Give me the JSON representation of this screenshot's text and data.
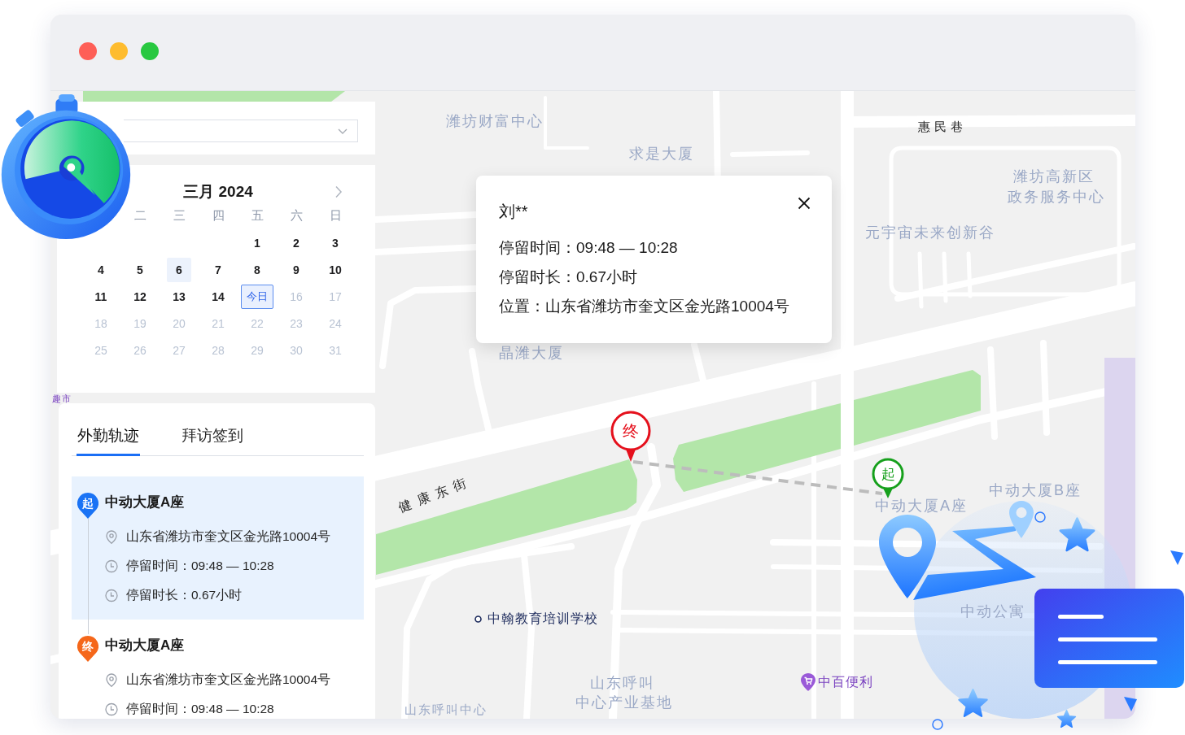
{
  "window": {
    "controls": [
      {
        "kind": "close"
      },
      {
        "kind": "minimize"
      },
      {
        "kind": "maximize"
      }
    ]
  },
  "calendar": {
    "title": "三月 2024",
    "weekdays": [
      "二",
      "三",
      "四",
      "五",
      "六",
      "日"
    ],
    "weeks": [
      [
        {
          "label": "1",
          "selected": false,
          "today": false,
          "disabled": false
        },
        {
          "label": "2",
          "selected": false,
          "today": false,
          "disabled": false
        },
        {
          "label": "3",
          "selected": false,
          "today": false,
          "disabled": false
        }
      ],
      [
        {
          "label": "4",
          "selected": false,
          "today": false,
          "disabled": false
        },
        {
          "label": "5",
          "selected": false,
          "today": false,
          "disabled": false
        },
        {
          "label": "6",
          "selected": true,
          "today": false,
          "disabled": false
        },
        {
          "label": "7",
          "selected": false,
          "today": false,
          "disabled": false
        },
        {
          "label": "8",
          "selected": false,
          "today": false,
          "disabled": false
        },
        {
          "label": "9",
          "selected": false,
          "today": false,
          "disabled": false
        },
        {
          "label": "10",
          "selected": false,
          "today": false,
          "disabled": false
        }
      ],
      [
        {
          "label": "11",
          "selected": false,
          "today": false,
          "disabled": false
        },
        {
          "label": "12",
          "selected": false,
          "today": false,
          "disabled": false
        },
        {
          "label": "13",
          "selected": false,
          "today": false,
          "disabled": false
        },
        {
          "label": "14",
          "selected": false,
          "today": false,
          "disabled": false
        },
        {
          "label": "今日",
          "selected": false,
          "today": true,
          "disabled": false
        },
        {
          "label": "16",
          "selected": false,
          "today": false,
          "disabled": true
        },
        {
          "label": "17",
          "selected": false,
          "today": false,
          "disabled": true
        }
      ],
      [
        {
          "label": "18",
          "selected": false,
          "today": false,
          "disabled": true
        },
        {
          "label": "19",
          "selected": false,
          "today": false,
          "disabled": true
        },
        {
          "label": "20",
          "selected": false,
          "today": false,
          "disabled": true
        },
        {
          "label": "21",
          "selected": false,
          "today": false,
          "disabled": true
        },
        {
          "label": "22",
          "selected": false,
          "today": false,
          "disabled": true
        },
        {
          "label": "23",
          "selected": false,
          "today": false,
          "disabled": true
        },
        {
          "label": "24",
          "selected": false,
          "today": false,
          "disabled": true
        }
      ],
      [
        {
          "label": "25",
          "selected": false,
          "today": false,
          "disabled": true
        },
        {
          "label": "26",
          "selected": false,
          "today": false,
          "disabled": true
        },
        {
          "label": "27",
          "selected": false,
          "today": false,
          "disabled": true
        },
        {
          "label": "28",
          "selected": false,
          "today": false,
          "disabled": true
        },
        {
          "label": "29",
          "selected": false,
          "today": false,
          "disabled": true
        },
        {
          "label": "30",
          "selected": false,
          "today": false,
          "disabled": true
        },
        {
          "label": "31",
          "selected": false,
          "today": false,
          "disabled": true
        }
      ]
    ]
  },
  "tabs": [
    {
      "label": "外勤轨迹",
      "selected": true
    },
    {
      "label": "拜访签到",
      "selected": false
    }
  ],
  "visits": [
    {
      "marker": "起",
      "color": "#1a73f5",
      "title": "中动大厦A座",
      "selected": true,
      "rows": [
        {
          "kind": "address",
          "text": "山东省潍坊市奎文区金光路10004号"
        },
        {
          "kind": "time",
          "text": "停留时间：09:48 — 10:28"
        },
        {
          "kind": "time",
          "text": "停留时长：0.67小时"
        }
      ]
    },
    {
      "marker": "终",
      "color": "#f5671a",
      "title": "中动大厦A座",
      "selected": false,
      "rows": [
        {
          "kind": "address",
          "text": "山东省潍坊市奎文区金光路10004号"
        },
        {
          "kind": "time",
          "text": "停留时间：09:48 — 10:28"
        }
      ]
    }
  ],
  "map": {
    "labels": [
      {
        "text": "潍坊财富中心",
        "kind": "area"
      },
      {
        "text": "求是大厦",
        "kind": "area"
      },
      {
        "text": "惠民巷",
        "kind": "road"
      },
      {
        "text": "潍坊高新区",
        "kind": "area"
      },
      {
        "text": "政务服务中心",
        "kind": "area"
      },
      {
        "text": "元宇宙未来创新谷",
        "kind": "area"
      },
      {
        "text": "晶潍大厦",
        "kind": "area"
      },
      {
        "text": "趣市",
        "kind": "district"
      },
      {
        "text": "健康东街",
        "kind": "road"
      },
      {
        "text": "中动大厦B座",
        "kind": "area"
      },
      {
        "text": "中动大厦A座",
        "kind": "area"
      },
      {
        "text": "中动公寓",
        "kind": "area"
      },
      {
        "text": "中翰教育培训学校",
        "kind": "poi"
      },
      {
        "text": "山东呼叫",
        "kind": "area"
      },
      {
        "text": "中心产业基地",
        "kind": "area"
      },
      {
        "text": "中百便利",
        "kind": "shop"
      },
      {
        "text": "山东呼叫中心",
        "kind": "area"
      }
    ],
    "markers": [
      {
        "label": "终",
        "color": "#e5101c"
      },
      {
        "label": "起",
        "color": "#16a01c"
      }
    ],
    "popup": {
      "title": "刘**",
      "lines": [
        "停留时间：09:48 — 10:28",
        "停留时长：0.67小时",
        "位置：山东省潍坊市奎文区金光路10004号"
      ]
    }
  }
}
